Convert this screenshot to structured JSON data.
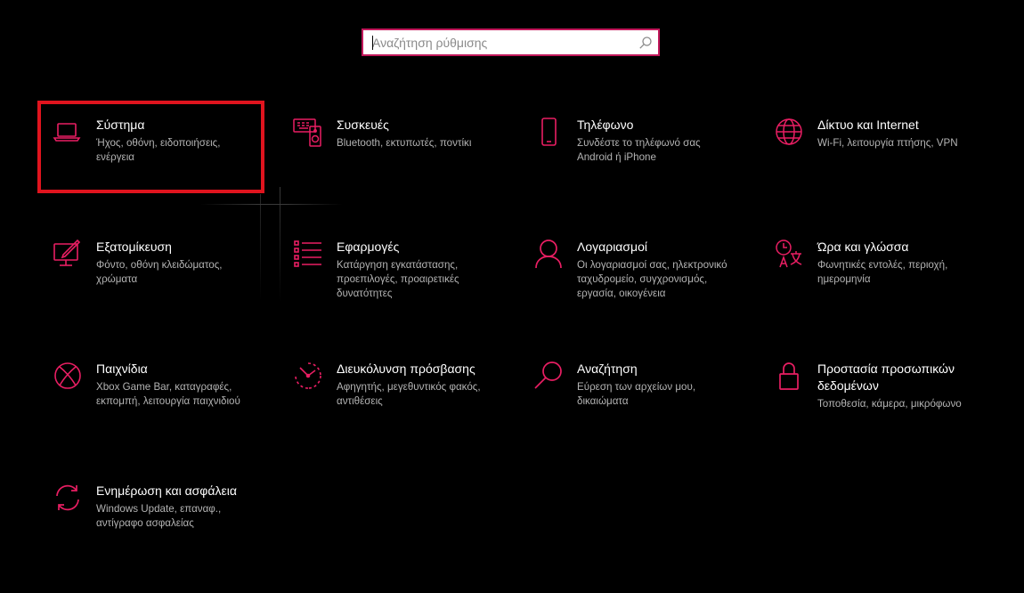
{
  "search": {
    "placeholder": "Αναζήτηση ρύθμισης"
  },
  "colors": {
    "accent": "#e91e63",
    "highlight": "#e0141e",
    "background": "#000000",
    "title": "#ffffff",
    "description": "#b3b3b3"
  },
  "tiles": [
    {
      "icon": "laptop-icon",
      "title": "Σύστημα",
      "desc": "Ήχος, οθόνη, ειδοποιήσεις, ενέργεια"
    },
    {
      "icon": "devices-icon",
      "title": "Συσκευές",
      "desc": "Bluetooth, εκτυπωτές, ποντίκι"
    },
    {
      "icon": "phone-icon",
      "title": "Τηλέφωνο",
      "desc": "Συνδέστε το τηλέφωνό σας Android ή iPhone"
    },
    {
      "icon": "globe-icon",
      "title": "Δίκτυο και Internet",
      "desc": "Wi-Fi, λειτουργία πτήσης, VPN"
    },
    {
      "icon": "personalization-icon",
      "title": "Εξατομίκευση",
      "desc": "Φόντο, οθόνη κλειδώματος, χρώματα"
    },
    {
      "icon": "apps-list-icon",
      "title": "Εφαρμογές",
      "desc": "Κατάργηση εγκατάστασης, προεπιλογές, προαιρετικές δυνατότητες"
    },
    {
      "icon": "person-icon",
      "title": "Λογαριασμοί",
      "desc": "Οι λογαριασμοί σας, ηλεκτρονικό ταχυδρομείο, συγχρονισμός, εργασία, οικογένεια"
    },
    {
      "icon": "time-language-icon",
      "title": "Ώρα και γλώσσα",
      "desc": "Φωνητικές εντολές, περιοχή, ημερομηνία"
    },
    {
      "icon": "xbox-icon",
      "title": "Παιχνίδια",
      "desc": "Xbox Game Bar, καταγραφές, εκπομπή, λειτουργία παιχνιδιού"
    },
    {
      "icon": "ease-of-access-icon",
      "title": "Διευκόλυνση πρόσβασης",
      "desc": "Αφηγητής, μεγεθυντικός φακός, αντιθέσεις"
    },
    {
      "icon": "search-magnifier-icon",
      "title": "Αναζήτηση",
      "desc": "Εύρεση των αρχείων μου, δικαιώματα"
    },
    {
      "icon": "lock-icon",
      "title": "Προστασία προσωπικών δεδομένων",
      "desc": "Τοποθεσία, κάμερα, μικρόφωνο"
    },
    {
      "icon": "sync-icon",
      "title": "Ενημέρωση και ασφάλεια",
      "desc": "Windows Update, επαναφ., αντίγραφο ασφαλείας"
    }
  ]
}
